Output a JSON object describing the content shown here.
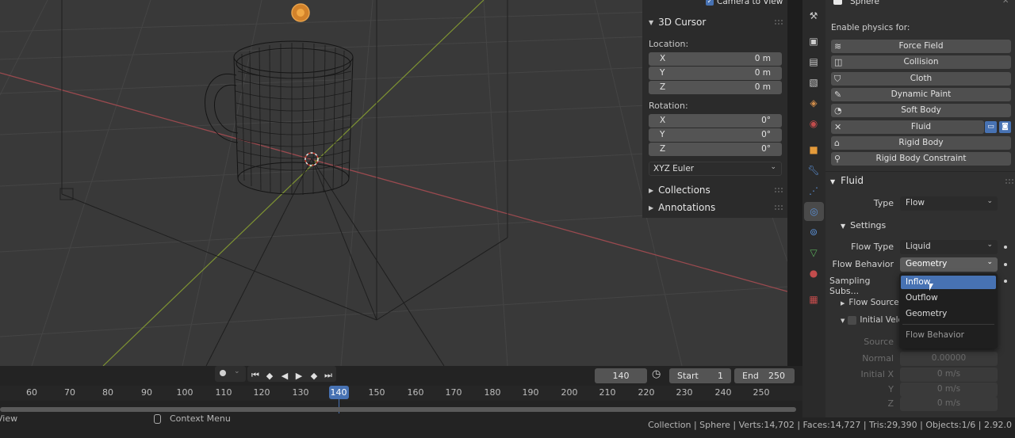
{
  "npanel": {
    "camera_to_view": "Camera to View",
    "cursor_title": "3D Cursor",
    "location_label": "Location:",
    "location": [
      {
        "axis": "X",
        "value": "0 m"
      },
      {
        "axis": "Y",
        "value": "0 m"
      },
      {
        "axis": "Z",
        "value": "0 m"
      }
    ],
    "rotation_label": "Rotation:",
    "rotation": [
      {
        "axis": "X",
        "value": "0°"
      },
      {
        "axis": "Y",
        "value": "0°"
      },
      {
        "axis": "Z",
        "value": "0°"
      }
    ],
    "rotation_mode": "XYZ Euler",
    "collections": "Collections",
    "annotations": "Annotations"
  },
  "properties": {
    "object_name": "Sphere",
    "enable_physics_label": "Enable physics for:",
    "physics_buttons": [
      {
        "label": "Force Field",
        "icon": "force-field-icon"
      },
      {
        "label": "Collision",
        "icon": "collision-icon"
      },
      {
        "label": "Cloth",
        "icon": "cloth-icon"
      },
      {
        "label": "Dynamic Paint",
        "icon": "dynamic-paint-icon"
      },
      {
        "label": "Soft Body",
        "icon": "soft-body-icon"
      },
      {
        "label": "Fluid",
        "icon": "close-icon"
      },
      {
        "label": "Rigid Body",
        "icon": "rigid-body-icon"
      },
      {
        "label": "Rigid Body Constraint",
        "icon": "rigid-body-constraint-icon"
      }
    ],
    "fluid_section": "Fluid",
    "type_label": "Type",
    "type_value": "Flow",
    "settings_section": "Settings",
    "flow_type_label": "Flow Type",
    "flow_type_value": "Liquid",
    "flow_behavior_label": "Flow Behavior",
    "flow_behavior_value": "Geometry",
    "sampling_label": "Sampling Subs...",
    "flow_source_label": "Flow Source",
    "initial_velocity_label": "Initial Velo",
    "source_label": "Source",
    "normal_label": "Normal",
    "normal_value": "0.00000",
    "initial_x_label": "Initial X",
    "initial_x_value": "0 m/s",
    "y_label": "Y",
    "y_value": "0 m/s",
    "z_label": "Z",
    "z_value": "0 m/s"
  },
  "dropdown": {
    "options": [
      "Inflow",
      "Outflow",
      "Geometry"
    ],
    "highlighted": "Inflow",
    "title": "Flow Behavior"
  },
  "timeline": {
    "current_frame": "140",
    "start_label": "Start",
    "start_value": "1",
    "end_label": "End",
    "end_value": "250",
    "frame_numbers": [
      "60",
      "70",
      "80",
      "90",
      "100",
      "110",
      "120",
      "130",
      "140",
      "150",
      "160",
      "170",
      "180",
      "190",
      "200",
      "210",
      "220",
      "230",
      "240",
      "250"
    ]
  },
  "statusbar": {
    "left_text": "View",
    "context_menu": "Context Menu",
    "stats": "Collection | Sphere | Verts:14,702 | Faces:14,727 | Tris:29,390 | Objects:1/6 | 2.92.0"
  },
  "colors": {
    "accent": "#4772b3",
    "x_axis": "#9a4a4f",
    "y_axis": "#7f9432",
    "viewport_bg": "#393939"
  }
}
